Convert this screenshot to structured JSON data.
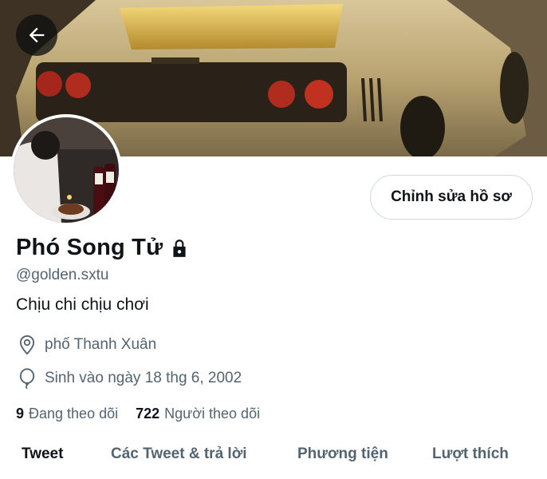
{
  "header": {
    "back_icon": "arrow-left-icon",
    "banner_description_icon": "banner-image"
  },
  "profile": {
    "display_name": "Phó Song Tử",
    "lock_icon": "lock-icon",
    "handle": "@golden.sxtu",
    "bio": "Chịu chi chịu chơi",
    "location": "phố Thanh Xuân",
    "birthday": "Sinh vào ngày 18 thg 6, 2002",
    "edit_button": "Chỉnh sửa hồ sơ"
  },
  "stats": {
    "following_count": "9",
    "following_label": "Đang theo dõi",
    "followers_count": "722",
    "followers_label": "Người theo dõi"
  },
  "tabs": [
    {
      "label": "Tweet",
      "active": true
    },
    {
      "label": "Các Tweet & trả lời",
      "active": false
    },
    {
      "label": "Phương tiện",
      "active": false
    },
    {
      "label": "Lượt thích",
      "active": false
    }
  ],
  "colors": {
    "text_primary": "#0f1419",
    "text_secondary": "#536471",
    "border": "#cfd9de"
  }
}
